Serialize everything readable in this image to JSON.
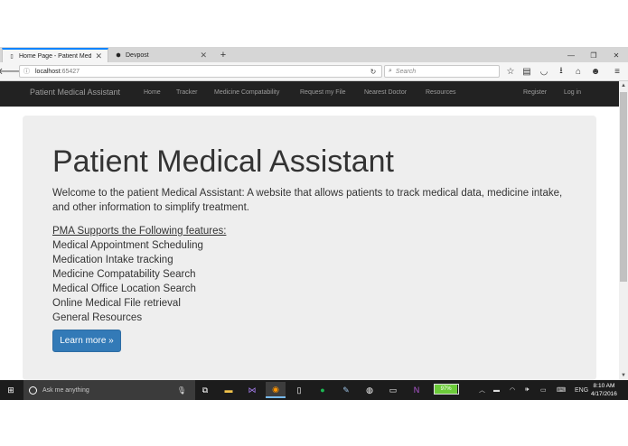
{
  "browser": {
    "tabs": [
      {
        "title": "Home Page - Patient Med...",
        "active": true
      },
      {
        "title": "Devpost",
        "active": false
      }
    ],
    "new_tab": "+",
    "url_host": "localhost",
    "url_port": ":65427",
    "search_placeholder": "Search"
  },
  "site": {
    "brand": "Patient Medical Assistant",
    "nav_links": [
      "Home",
      "Tracker",
      "Medicine Compatability",
      "Request my File",
      "Nearest Doctor",
      "Resources"
    ],
    "right_links": [
      "Register",
      "Log in"
    ]
  },
  "jumbotron": {
    "title": "Patient Medical Assistant",
    "lead": "Welcome to the patient Medical Assistant: A website that allows patients to track medical data, medicine intake, and other information to simplify treatment.",
    "features_heading": "PMA Supports the Following features:",
    "features": [
      "Medical Appointment Scheduling",
      "Medication Intake tracking",
      "Medicine Compatability Search",
      "Medical Office Location Search",
      "Online Medical File retrieval",
      "General Resources"
    ],
    "button": "Learn more »"
  },
  "taskbar": {
    "search_placeholder": "Ask me anything",
    "battery": "97%",
    "battery_level": 0.97,
    "language": "ENG",
    "time": "8:10 AM",
    "date": "4/17/2016"
  },
  "colors": {
    "site_nav": "#222222",
    "jumbotron": "#eeeeee",
    "primary_button": "#337ab7",
    "taskbar": "#1c1c1c"
  }
}
